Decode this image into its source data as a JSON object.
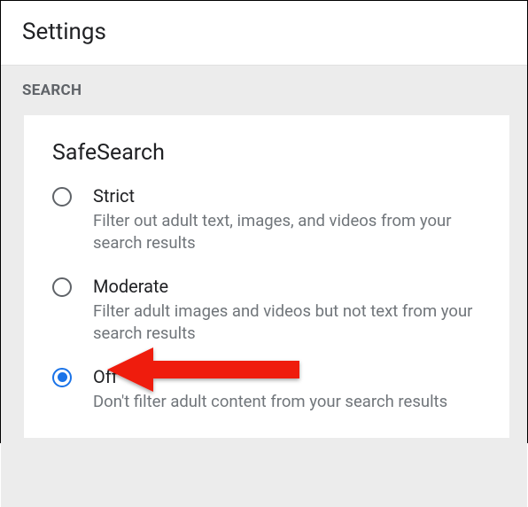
{
  "header": {
    "title": "Settings"
  },
  "section": {
    "label": "SEARCH"
  },
  "card": {
    "title": "SafeSearch",
    "options": [
      {
        "label": "Strict",
        "description": "Filter out adult text, images, and videos from your search results",
        "selected": false
      },
      {
        "label": "Moderate",
        "description": "Filter adult images and videos but not text from your search results",
        "selected": false
      },
      {
        "label": "Off",
        "description": "Don't filter adult content from your search results",
        "selected": true
      }
    ]
  },
  "colors": {
    "accent": "#1a73e8",
    "annotation": "#ef1a0f"
  }
}
